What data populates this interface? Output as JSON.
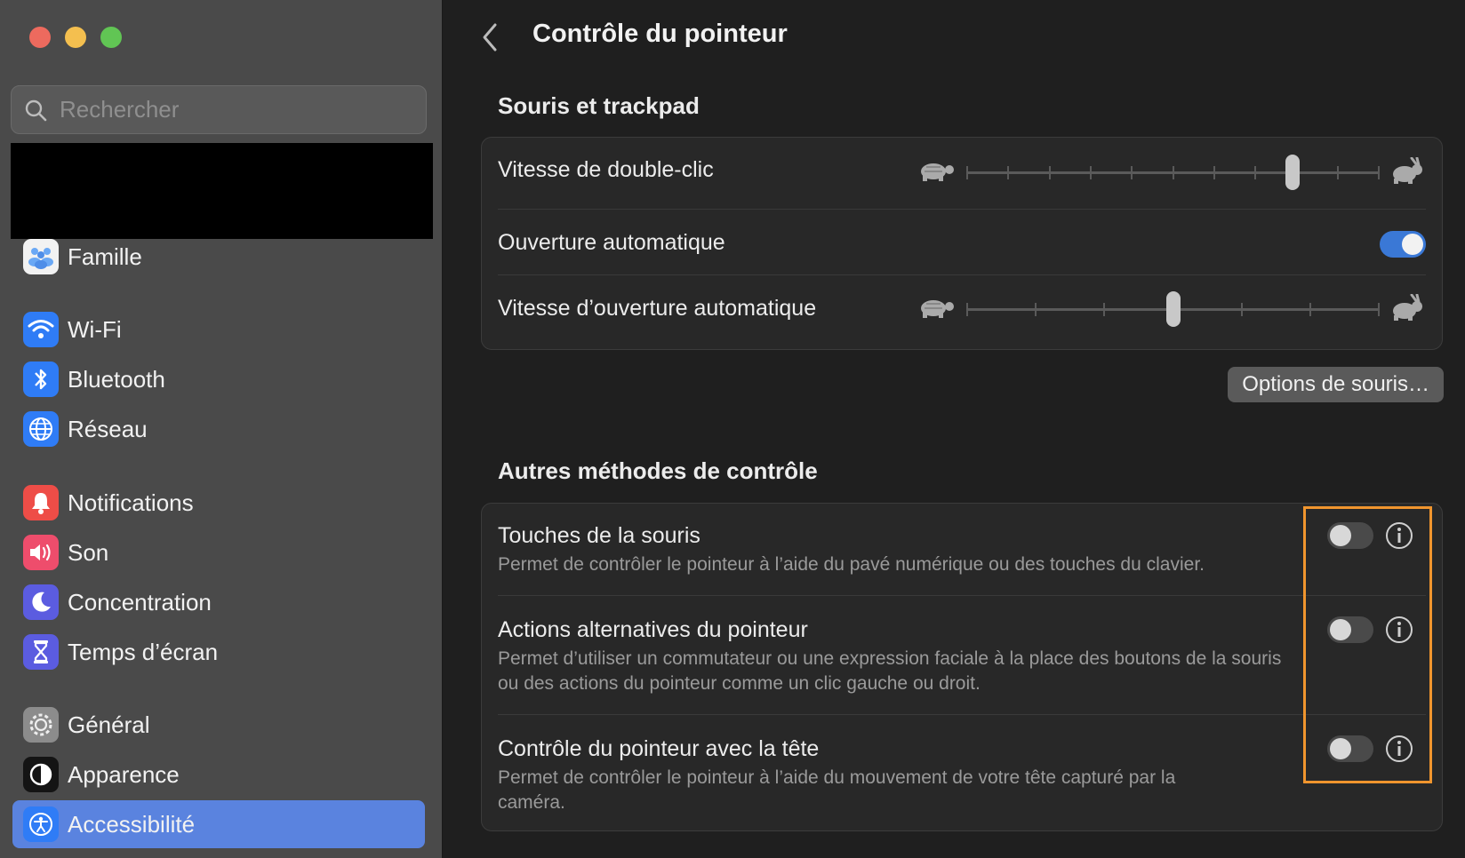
{
  "window": {
    "title": "Contrôle du pointeur"
  },
  "sidebar": {
    "search_placeholder": "Rechercher",
    "items": [
      {
        "label": "Famille",
        "icon": "family-icon"
      },
      {
        "label": "Wi-Fi",
        "icon": "wifi-icon"
      },
      {
        "label": "Bluetooth",
        "icon": "bluetooth-icon"
      },
      {
        "label": "Réseau",
        "icon": "network-globe-icon"
      },
      {
        "label": "Notifications",
        "icon": "bell-icon"
      },
      {
        "label": "Son",
        "icon": "speaker-icon"
      },
      {
        "label": "Concentration",
        "icon": "moon-icon"
      },
      {
        "label": "Temps d’écran",
        "icon": "hourglass-icon"
      },
      {
        "label": "Général",
        "icon": "gear-icon"
      },
      {
        "label": "Apparence",
        "icon": "appearance-icon"
      },
      {
        "label": "Accessibilité",
        "icon": "accessibility-icon",
        "selected": true
      }
    ]
  },
  "main": {
    "section1": {
      "heading": "Souris et trackpad",
      "double_click_speed": {
        "label": "Vitesse de double-clic",
        "ticks": 11,
        "value_fraction": 0.79
      },
      "spring_loading": {
        "label": "Ouverture automatique",
        "on": true
      },
      "spring_loading_speed": {
        "label": "Vitesse d’ouverture automatique",
        "ticks": 7,
        "value_fraction": 0.5
      }
    },
    "mouse_options_button": "Options de souris…",
    "section2": {
      "heading": "Autres méthodes de contrôle",
      "rows": [
        {
          "label": "Touches de la souris",
          "desc": "Permet de contrôler le pointeur à l’aide du pavé numérique ou des touches du clavier.",
          "on": false
        },
        {
          "label": "Actions alternatives du pointeur",
          "desc": "Permet d’utiliser un commutateur ou une expression faciale à la place des boutons de la souris ou des actions du pointeur comme un clic gauche ou droit.",
          "on": false
        },
        {
          "label": "Contrôle du pointeur avec la tête",
          "desc": "Permet de contrôler le pointeur à l’aide du mouvement de votre tête capturé par la caméra.",
          "on": false
        }
      ]
    }
  },
  "colors": {
    "accent": "#3a78d6",
    "selection": "#5a83df",
    "highlight_outline": "#f0952e"
  }
}
